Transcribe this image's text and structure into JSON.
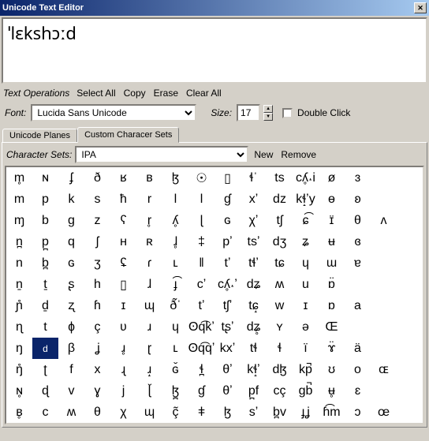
{
  "title": "Unicode Text Editor",
  "editor_text": "ˈlɛkshɔːd",
  "ops": {
    "label": "Text Operations",
    "select_all": "Select All",
    "copy": "Copy",
    "erase": "Erase",
    "clear_all": "Clear All"
  },
  "font": {
    "label": "Font:",
    "value": "Lucida Sans Unicode"
  },
  "size": {
    "label": "Size:",
    "value": "17"
  },
  "double_click": "Double Click",
  "tabs": {
    "planes": "Unicode Planes",
    "custom": "Custom Characer Sets"
  },
  "sets": {
    "label": "Character Sets:",
    "value": "IPA",
    "new": "New",
    "remove": "Remove"
  },
  "selected_cell": "d",
  "chart_data": {
    "type": "table",
    "title": "IPA character palette",
    "rows": [
      [
        "m̥",
        "ɴ",
        "ʄ",
        "ð",
        "ʁ",
        "ʙ",
        "ɮ",
        "☉",
        "▯",
        "ɬˈ",
        "ts",
        "cʎ̥˔i",
        "ø",
        "ɜ"
      ],
      [
        "m",
        "p",
        "k",
        "s",
        "ħ",
        "r",
        "ǀ",
        "l",
        "ɠ",
        "xʼ",
        "dz",
        "kɬ̝ʼy",
        "ɵ",
        "ʚ"
      ],
      [
        "ɱ",
        "b",
        "ɡ",
        "z",
        "ʕ",
        "r̥",
        "ʎ̥",
        "ɭ",
        "ɢ",
        "χʼ",
        "tʃ",
        "ɕ͡",
        "ɪ̈",
        "θ",
        "ʌ"
      ],
      [
        "n̪",
        "p̪",
        "q",
        "ʃ",
        "ʜ",
        "ʀ",
        "ɺ̥",
        "‡",
        "pʼ",
        "tsʼ",
        "dʒ",
        "ʑ",
        "ʉ",
        "ɞ"
      ],
      [
        "n",
        "b̪",
        "ɢ",
        "ʒ",
        "ʢ",
        "ɾ",
        "ʟ",
        "‖",
        "tʼ",
        "tɬʼ",
        "tɕ",
        "ɥ",
        "ɯ",
        "ɐ"
      ],
      [
        "ṉ",
        "ṯ",
        "ʂ",
        "h",
        "▯",
        "ɺ",
        "ɟ͡",
        "cʼ",
        "cʎ̥˔ʼ",
        "dʑ",
        "ʍ",
        "u",
        "ɒ̈"
      ],
      [
        "ɲ̊",
        "ḏ",
        "ʐ",
        "ɦ",
        "ɪ",
        "ɰ",
        "ð̃ˈ",
        "tʼ",
        "tʃʼ",
        "tɕ̝",
        "w",
        "ɪ",
        "ɒ",
        "a"
      ],
      [
        "ɳ",
        "t",
        "ɸ",
        "ç",
        "ʋ",
        "ɹ",
        "ɥ",
        "ʘq͡kʼ",
        "tʂʼ",
        "dʑ̥",
        "ʏ",
        "ə",
        "Œ"
      ],
      [
        "ŋ",
        "d",
        "β",
        "ʝ",
        "ɹ̥",
        "ɽ",
        "ʟ",
        "ʘq͡qʼ",
        "kxʼ",
        "tɬ",
        "ɬ",
        "ï",
        "ɤ̈",
        "ä"
      ],
      [
        "ŋ̊",
        "ʈ",
        "f",
        "x",
        "ɻ",
        "ɹ̝",
        "ɢ̆",
        "ɬ̪",
        "θʼ",
        "kɬ̝ʼ",
        "dɮ",
        "kp̚",
        "ʊ",
        "o",
        "ɶ"
      ],
      [
        "ɴ̥",
        "ɖ",
        "v",
        "ɣ",
        "j",
        "ɭ̆",
        "ɮ̪",
        "ɠ",
        "θʼ",
        "p̪f",
        "cç",
        "ɡb̚",
        "ʉ̥",
        "ɛ"
      ],
      [
        "ʙ̥",
        "c",
        "ʍ",
        "θ",
        "χ",
        "ɰ",
        "ç̃",
        "ǂ",
        "ɮ",
        "sʼ",
        "b̪v",
        "ɟʝ",
        "ɦ͡m",
        "ɔ",
        "œ"
      ]
    ]
  }
}
